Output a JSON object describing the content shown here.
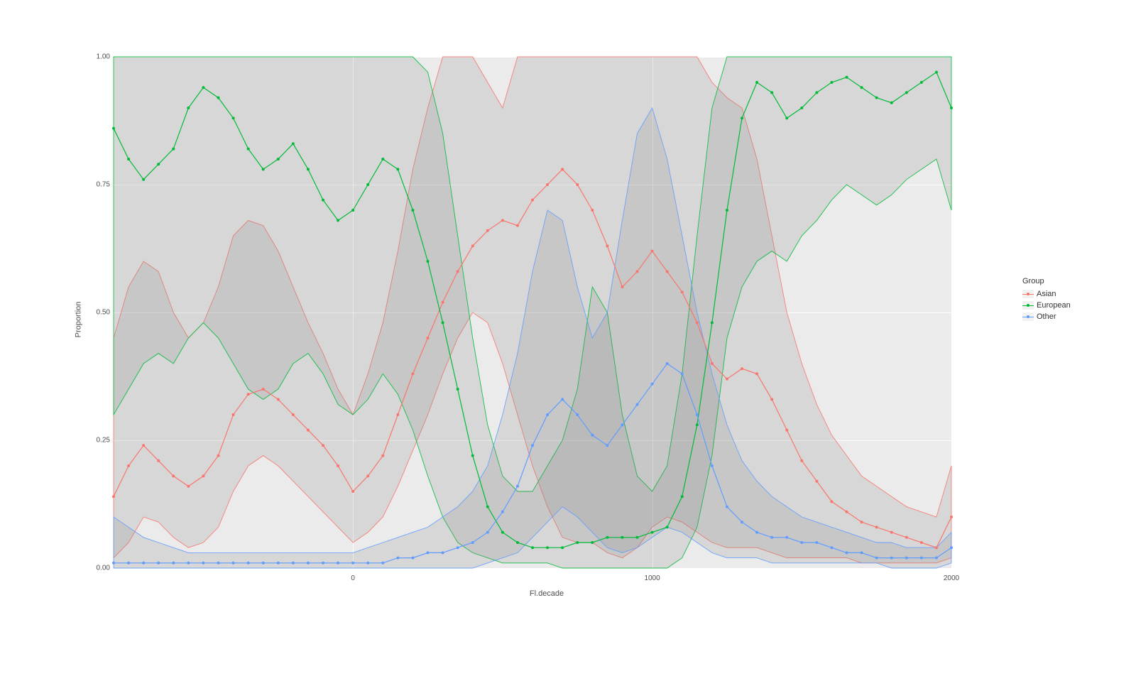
{
  "chart_data": {
    "type": "line",
    "title": "",
    "xlabel": "Fl.decade",
    "ylabel": "Proportion",
    "xlim": [
      -800,
      2000
    ],
    "ylim": [
      0,
      1
    ],
    "x_ticks": [
      0,
      1000,
      2000
    ],
    "y_ticks": [
      0.0,
      0.25,
      0.5,
      0.75,
      1.0
    ],
    "x": [
      -800,
      -750,
      -700,
      -650,
      -600,
      -550,
      -500,
      -450,
      -400,
      -350,
      -300,
      -250,
      -200,
      -150,
      -100,
      -50,
      0,
      50,
      100,
      150,
      200,
      250,
      300,
      350,
      400,
      450,
      500,
      550,
      600,
      650,
      700,
      750,
      800,
      850,
      900,
      950,
      1000,
      1050,
      1100,
      1150,
      1200,
      1250,
      1300,
      1350,
      1400,
      1450,
      1500,
      1550,
      1600,
      1650,
      1700,
      1750,
      1800,
      1850,
      1900,
      1950,
      2000
    ],
    "series": [
      {
        "name": "Asian",
        "color": "#F8766D",
        "values": [
          0.14,
          0.2,
          0.24,
          0.21,
          0.18,
          0.16,
          0.18,
          0.22,
          0.3,
          0.34,
          0.35,
          0.33,
          0.3,
          0.27,
          0.24,
          0.2,
          0.15,
          0.18,
          0.22,
          0.3,
          0.38,
          0.45,
          0.52,
          0.58,
          0.63,
          0.66,
          0.68,
          0.67,
          0.72,
          0.75,
          0.78,
          0.75,
          0.7,
          0.63,
          0.55,
          0.58,
          0.62,
          0.58,
          0.54,
          0.48,
          0.4,
          0.37,
          0.39,
          0.38,
          0.33,
          0.27,
          0.21,
          0.17,
          0.13,
          0.11,
          0.09,
          0.08,
          0.07,
          0.06,
          0.05,
          0.04,
          0.1
        ],
        "lower": [
          0.02,
          0.05,
          0.1,
          0.09,
          0.06,
          0.04,
          0.05,
          0.08,
          0.15,
          0.2,
          0.22,
          0.2,
          0.17,
          0.14,
          0.11,
          0.08,
          0.05,
          0.07,
          0.1,
          0.16,
          0.23,
          0.3,
          0.38,
          0.45,
          0.5,
          0.48,
          0.4,
          0.3,
          0.2,
          0.12,
          0.06,
          0.05,
          0.05,
          0.03,
          0.02,
          0.04,
          0.08,
          0.1,
          0.09,
          0.07,
          0.05,
          0.04,
          0.04,
          0.04,
          0.03,
          0.02,
          0.02,
          0.02,
          0.02,
          0.02,
          0.01,
          0.01,
          0.01,
          0.01,
          0.01,
          0.01,
          0.02
        ],
        "upper": [
          0.45,
          0.55,
          0.6,
          0.58,
          0.5,
          0.45,
          0.48,
          0.55,
          0.65,
          0.68,
          0.67,
          0.62,
          0.55,
          0.48,
          0.42,
          0.35,
          0.3,
          0.38,
          0.48,
          0.62,
          0.78,
          0.9,
          1.0,
          1.0,
          1.0,
          0.95,
          0.9,
          1.0,
          1.0,
          1.0,
          1.0,
          1.0,
          1.0,
          1.0,
          1.0,
          1.0,
          1.0,
          1.0,
          1.0,
          1.0,
          0.95,
          0.92,
          0.9,
          0.8,
          0.65,
          0.5,
          0.4,
          0.32,
          0.26,
          0.22,
          0.18,
          0.16,
          0.14,
          0.12,
          0.11,
          0.1,
          0.2
        ]
      },
      {
        "name": "European",
        "color": "#00BA38",
        "values": [
          0.86,
          0.8,
          0.76,
          0.79,
          0.82,
          0.9,
          0.94,
          0.92,
          0.88,
          0.82,
          0.78,
          0.8,
          0.83,
          0.78,
          0.72,
          0.68,
          0.7,
          0.75,
          0.8,
          0.78,
          0.7,
          0.6,
          0.48,
          0.35,
          0.22,
          0.12,
          0.07,
          0.05,
          0.04,
          0.04,
          0.04,
          0.05,
          0.05,
          0.06,
          0.06,
          0.06,
          0.07,
          0.08,
          0.14,
          0.28,
          0.48,
          0.7,
          0.88,
          0.95,
          0.93,
          0.88,
          0.9,
          0.93,
          0.95,
          0.96,
          0.94,
          0.92,
          0.91,
          0.93,
          0.95,
          0.97,
          0.9
        ],
        "lower": [
          0.3,
          0.35,
          0.4,
          0.42,
          0.4,
          0.45,
          0.48,
          0.45,
          0.4,
          0.35,
          0.33,
          0.35,
          0.4,
          0.42,
          0.38,
          0.32,
          0.3,
          0.33,
          0.38,
          0.34,
          0.27,
          0.18,
          0.1,
          0.05,
          0.03,
          0.02,
          0.01,
          0.01,
          0.01,
          0.01,
          0.0,
          0.0,
          0.0,
          0.0,
          0.0,
          0.0,
          0.0,
          0.0,
          0.02,
          0.08,
          0.22,
          0.45,
          0.55,
          0.6,
          0.62,
          0.6,
          0.65,
          0.68,
          0.72,
          0.75,
          0.73,
          0.71,
          0.73,
          0.76,
          0.78,
          0.8,
          0.7
        ],
        "upper": [
          1.0,
          1.0,
          1.0,
          1.0,
          1.0,
          1.0,
          1.0,
          1.0,
          1.0,
          1.0,
          1.0,
          1.0,
          1.0,
          1.0,
          1.0,
          1.0,
          1.0,
          1.0,
          1.0,
          1.0,
          1.0,
          0.97,
          0.85,
          0.65,
          0.45,
          0.28,
          0.18,
          0.15,
          0.15,
          0.2,
          0.25,
          0.35,
          0.55,
          0.5,
          0.3,
          0.18,
          0.15,
          0.2,
          0.38,
          0.65,
          0.9,
          1.0,
          1.0,
          1.0,
          1.0,
          1.0,
          1.0,
          1.0,
          1.0,
          1.0,
          1.0,
          1.0,
          1.0,
          1.0,
          1.0,
          1.0,
          1.0
        ]
      },
      {
        "name": "Other",
        "color": "#619CFF",
        "values": [
          0.01,
          0.01,
          0.01,
          0.01,
          0.01,
          0.01,
          0.01,
          0.01,
          0.01,
          0.01,
          0.01,
          0.01,
          0.01,
          0.01,
          0.01,
          0.01,
          0.01,
          0.01,
          0.01,
          0.02,
          0.02,
          0.03,
          0.03,
          0.04,
          0.05,
          0.07,
          0.11,
          0.16,
          0.24,
          0.3,
          0.33,
          0.3,
          0.26,
          0.24,
          0.28,
          0.32,
          0.36,
          0.4,
          0.38,
          0.3,
          0.2,
          0.12,
          0.09,
          0.07,
          0.06,
          0.06,
          0.05,
          0.05,
          0.04,
          0.03,
          0.03,
          0.02,
          0.02,
          0.02,
          0.02,
          0.02,
          0.04
        ],
        "lower": [
          0.0,
          0.0,
          0.0,
          0.0,
          0.0,
          0.0,
          0.0,
          0.0,
          0.0,
          0.0,
          0.0,
          0.0,
          0.0,
          0.0,
          0.0,
          0.0,
          0.0,
          0.0,
          0.0,
          0.0,
          0.0,
          0.0,
          0.0,
          0.0,
          0.0,
          0.01,
          0.02,
          0.03,
          0.06,
          0.09,
          0.12,
          0.1,
          0.07,
          0.04,
          0.03,
          0.04,
          0.06,
          0.08,
          0.07,
          0.05,
          0.03,
          0.02,
          0.02,
          0.02,
          0.01,
          0.01,
          0.01,
          0.01,
          0.01,
          0.01,
          0.01,
          0.01,
          0.0,
          0.0,
          0.0,
          0.0,
          0.01
        ],
        "upper": [
          0.1,
          0.08,
          0.06,
          0.05,
          0.04,
          0.03,
          0.03,
          0.03,
          0.03,
          0.03,
          0.03,
          0.03,
          0.03,
          0.03,
          0.03,
          0.03,
          0.03,
          0.04,
          0.05,
          0.06,
          0.07,
          0.08,
          0.1,
          0.12,
          0.15,
          0.2,
          0.3,
          0.42,
          0.58,
          0.7,
          0.68,
          0.55,
          0.45,
          0.5,
          0.68,
          0.85,
          0.9,
          0.8,
          0.65,
          0.5,
          0.38,
          0.28,
          0.21,
          0.17,
          0.14,
          0.12,
          0.1,
          0.09,
          0.08,
          0.07,
          0.06,
          0.05,
          0.05,
          0.04,
          0.04,
          0.04,
          0.07
        ]
      }
    ],
    "legend": {
      "title": "Group",
      "position": "right"
    }
  },
  "axis": {
    "y_ticks": [
      "0.00",
      "0.25",
      "0.50",
      "0.75",
      "1.00"
    ],
    "x_ticks": [
      "0",
      "1000",
      "2000"
    ],
    "xlabel": "Fl.decade",
    "ylabel": "Proportion"
  },
  "legend": {
    "title": "Group",
    "items": [
      {
        "label": "Asian",
        "color": "#F8766D"
      },
      {
        "label": "European",
        "color": "#00BA38"
      },
      {
        "label": "Other",
        "color": "#619CFF"
      }
    ]
  }
}
